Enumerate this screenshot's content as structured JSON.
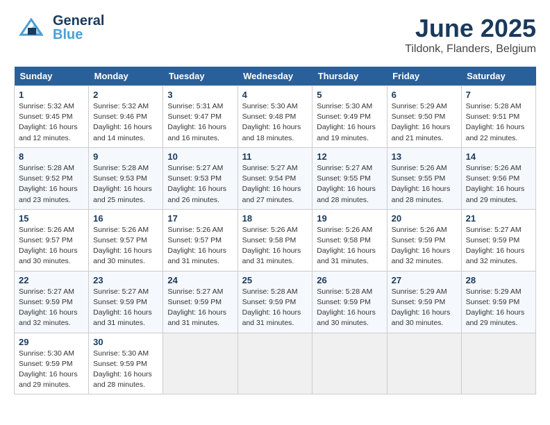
{
  "header": {
    "logo_general": "General",
    "logo_blue": "Blue",
    "month": "June 2025",
    "location": "Tildonk, Flanders, Belgium"
  },
  "weekdays": [
    "Sunday",
    "Monday",
    "Tuesday",
    "Wednesday",
    "Thursday",
    "Friday",
    "Saturday"
  ],
  "weeks": [
    [
      {
        "day": "1",
        "sunrise": "Sunrise: 5:32 AM",
        "sunset": "Sunset: 9:45 PM",
        "daylight": "Daylight: 16 hours and 12 minutes."
      },
      {
        "day": "2",
        "sunrise": "Sunrise: 5:32 AM",
        "sunset": "Sunset: 9:46 PM",
        "daylight": "Daylight: 16 hours and 14 minutes."
      },
      {
        "day": "3",
        "sunrise": "Sunrise: 5:31 AM",
        "sunset": "Sunset: 9:47 PM",
        "daylight": "Daylight: 16 hours and 16 minutes."
      },
      {
        "day": "4",
        "sunrise": "Sunrise: 5:30 AM",
        "sunset": "Sunset: 9:48 PM",
        "daylight": "Daylight: 16 hours and 18 minutes."
      },
      {
        "day": "5",
        "sunrise": "Sunrise: 5:30 AM",
        "sunset": "Sunset: 9:49 PM",
        "daylight": "Daylight: 16 hours and 19 minutes."
      },
      {
        "day": "6",
        "sunrise": "Sunrise: 5:29 AM",
        "sunset": "Sunset: 9:50 PM",
        "daylight": "Daylight: 16 hours and 21 minutes."
      },
      {
        "day": "7",
        "sunrise": "Sunrise: 5:28 AM",
        "sunset": "Sunset: 9:51 PM",
        "daylight": "Daylight: 16 hours and 22 minutes."
      }
    ],
    [
      {
        "day": "8",
        "sunrise": "Sunrise: 5:28 AM",
        "sunset": "Sunset: 9:52 PM",
        "daylight": "Daylight: 16 hours and 23 minutes."
      },
      {
        "day": "9",
        "sunrise": "Sunrise: 5:28 AM",
        "sunset": "Sunset: 9:53 PM",
        "daylight": "Daylight: 16 hours and 25 minutes."
      },
      {
        "day": "10",
        "sunrise": "Sunrise: 5:27 AM",
        "sunset": "Sunset: 9:53 PM",
        "daylight": "Daylight: 16 hours and 26 minutes."
      },
      {
        "day": "11",
        "sunrise": "Sunrise: 5:27 AM",
        "sunset": "Sunset: 9:54 PM",
        "daylight": "Daylight: 16 hours and 27 minutes."
      },
      {
        "day": "12",
        "sunrise": "Sunrise: 5:27 AM",
        "sunset": "Sunset: 9:55 PM",
        "daylight": "Daylight: 16 hours and 28 minutes."
      },
      {
        "day": "13",
        "sunrise": "Sunrise: 5:26 AM",
        "sunset": "Sunset: 9:55 PM",
        "daylight": "Daylight: 16 hours and 28 minutes."
      },
      {
        "day": "14",
        "sunrise": "Sunrise: 5:26 AM",
        "sunset": "Sunset: 9:56 PM",
        "daylight": "Daylight: 16 hours and 29 minutes."
      }
    ],
    [
      {
        "day": "15",
        "sunrise": "Sunrise: 5:26 AM",
        "sunset": "Sunset: 9:57 PM",
        "daylight": "Daylight: 16 hours and 30 minutes."
      },
      {
        "day": "16",
        "sunrise": "Sunrise: 5:26 AM",
        "sunset": "Sunset: 9:57 PM",
        "daylight": "Daylight: 16 hours and 30 minutes."
      },
      {
        "day": "17",
        "sunrise": "Sunrise: 5:26 AM",
        "sunset": "Sunset: 9:57 PM",
        "daylight": "Daylight: 16 hours and 31 minutes."
      },
      {
        "day": "18",
        "sunrise": "Sunrise: 5:26 AM",
        "sunset": "Sunset: 9:58 PM",
        "daylight": "Daylight: 16 hours and 31 minutes."
      },
      {
        "day": "19",
        "sunrise": "Sunrise: 5:26 AM",
        "sunset": "Sunset: 9:58 PM",
        "daylight": "Daylight: 16 hours and 31 minutes."
      },
      {
        "day": "20",
        "sunrise": "Sunrise: 5:26 AM",
        "sunset": "Sunset: 9:59 PM",
        "daylight": "Daylight: 16 hours and 32 minutes."
      },
      {
        "day": "21",
        "sunrise": "Sunrise: 5:27 AM",
        "sunset": "Sunset: 9:59 PM",
        "daylight": "Daylight: 16 hours and 32 minutes."
      }
    ],
    [
      {
        "day": "22",
        "sunrise": "Sunrise: 5:27 AM",
        "sunset": "Sunset: 9:59 PM",
        "daylight": "Daylight: 16 hours and 32 minutes."
      },
      {
        "day": "23",
        "sunrise": "Sunrise: 5:27 AM",
        "sunset": "Sunset: 9:59 PM",
        "daylight": "Daylight: 16 hours and 31 minutes."
      },
      {
        "day": "24",
        "sunrise": "Sunrise: 5:27 AM",
        "sunset": "Sunset: 9:59 PM",
        "daylight": "Daylight: 16 hours and 31 minutes."
      },
      {
        "day": "25",
        "sunrise": "Sunrise: 5:28 AM",
        "sunset": "Sunset: 9:59 PM",
        "daylight": "Daylight: 16 hours and 31 minutes."
      },
      {
        "day": "26",
        "sunrise": "Sunrise: 5:28 AM",
        "sunset": "Sunset: 9:59 PM",
        "daylight": "Daylight: 16 hours and 30 minutes."
      },
      {
        "day": "27",
        "sunrise": "Sunrise: 5:29 AM",
        "sunset": "Sunset: 9:59 PM",
        "daylight": "Daylight: 16 hours and 30 minutes."
      },
      {
        "day": "28",
        "sunrise": "Sunrise: 5:29 AM",
        "sunset": "Sunset: 9:59 PM",
        "daylight": "Daylight: 16 hours and 29 minutes."
      }
    ],
    [
      {
        "day": "29",
        "sunrise": "Sunrise: 5:30 AM",
        "sunset": "Sunset: 9:59 PM",
        "daylight": "Daylight: 16 hours and 29 minutes."
      },
      {
        "day": "30",
        "sunrise": "Sunrise: 5:30 AM",
        "sunset": "Sunset: 9:59 PM",
        "daylight": "Daylight: 16 hours and 28 minutes."
      },
      null,
      null,
      null,
      null,
      null
    ]
  ]
}
